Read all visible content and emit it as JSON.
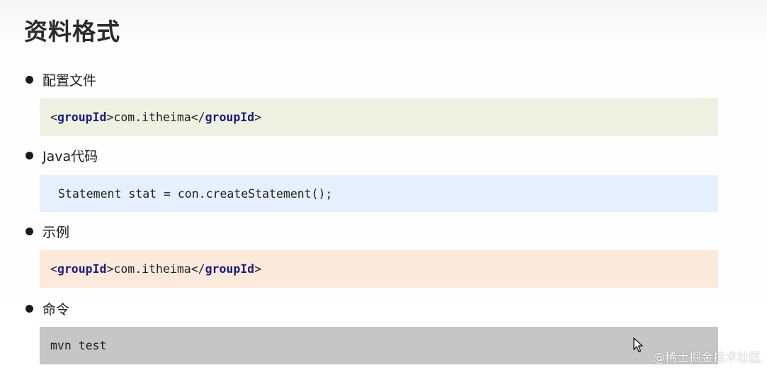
{
  "title": "资料格式",
  "sections": [
    {
      "label": "配置文件",
      "code": {
        "lt": "<",
        "tag": "groupId",
        "gt": ">",
        "text": "com.itheima",
        "lt_close": "</",
        "tag_close": "groupId",
        "gt_close": ">"
      }
    },
    {
      "label": "Java代码",
      "code": "Statement stat = con.createStatement();"
    },
    {
      "label": "示例",
      "code": {
        "lt": "<",
        "tag": "groupId",
        "gt": ">",
        "text": "com.itheima",
        "lt_close": "</",
        "tag_close": "groupId",
        "gt_close": ">"
      }
    },
    {
      "label": "命令",
      "code": "mvn test"
    }
  ],
  "watermark": "@稀土掘金技术社区",
  "colors": {
    "config_bg": "#eef1e2",
    "java_bg": "#e6effd",
    "example_bg": "#fbe9dc",
    "command_bg": "#c6c6c6",
    "tag_keyword": "#1b1b7a"
  },
  "icons": {
    "bullet": "bullet-dot-icon",
    "cursor": "mouse-pointer-icon"
  }
}
